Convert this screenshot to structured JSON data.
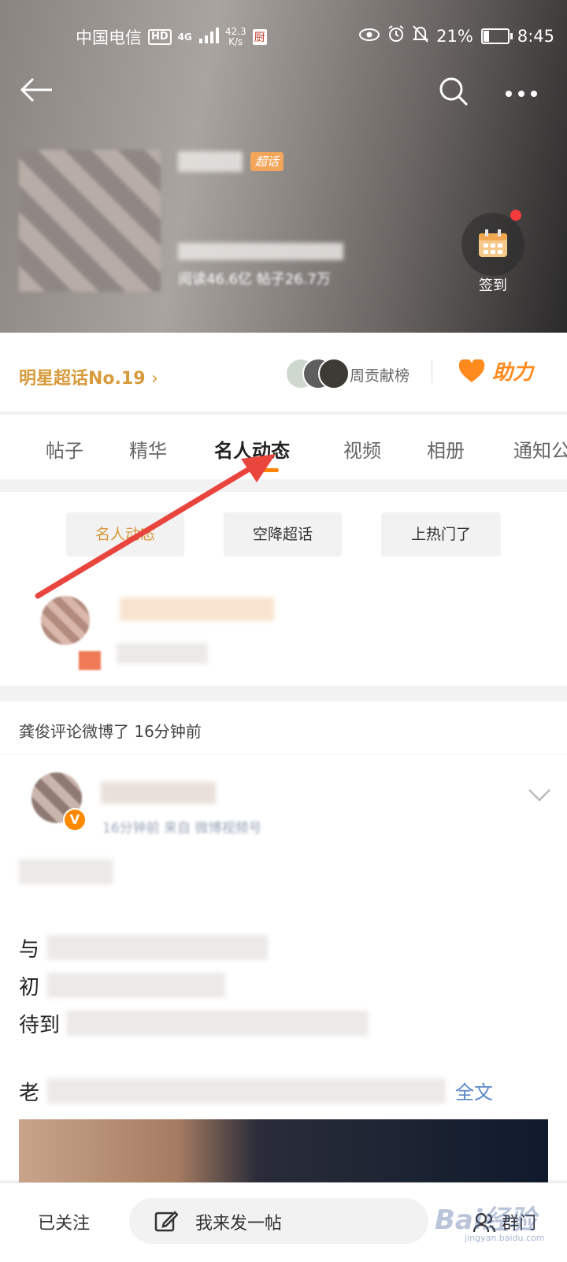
{
  "status_bar": {
    "carrier": "中国电信",
    "hd": "HD",
    "net": "4G",
    "speed_value": "42.3",
    "speed_unit": "K/s",
    "app_badge": "厨",
    "battery": "21%",
    "battery_level": 0.21,
    "time": "8:45"
  },
  "header": {
    "super_tag": "超话",
    "stats_text": "阅读46.6亿  帖子26.7万",
    "checkin_label": "签到"
  },
  "rank_row": {
    "rank_text": "明星超话No.19",
    "week_rank": "周贡献榜",
    "boost": "助力"
  },
  "tabs": [
    "帖子",
    "精华",
    "名人动态",
    "视频",
    "相册",
    "通知公"
  ],
  "filters": [
    "名人动态",
    "空降超话",
    "上热门了"
  ],
  "notice": "龚俊评论微博了 16分钟前",
  "post": {
    "meta": "16分钟前 来自 微博视频号",
    "line1": "与",
    "line2": "初",
    "line3": "待到",
    "line4": "老",
    "full_text": "全文"
  },
  "bottom": {
    "followed": "已关注",
    "compose": "我来发一帖",
    "right": "群门",
    "watermark": "Bai经验",
    "watermark_url": "jingyan.baidu.com"
  },
  "colors": {
    "accent": "#ff8200",
    "gold": "#d79a3b",
    "link": "#5b87c9",
    "arrow": "#e8453c"
  }
}
